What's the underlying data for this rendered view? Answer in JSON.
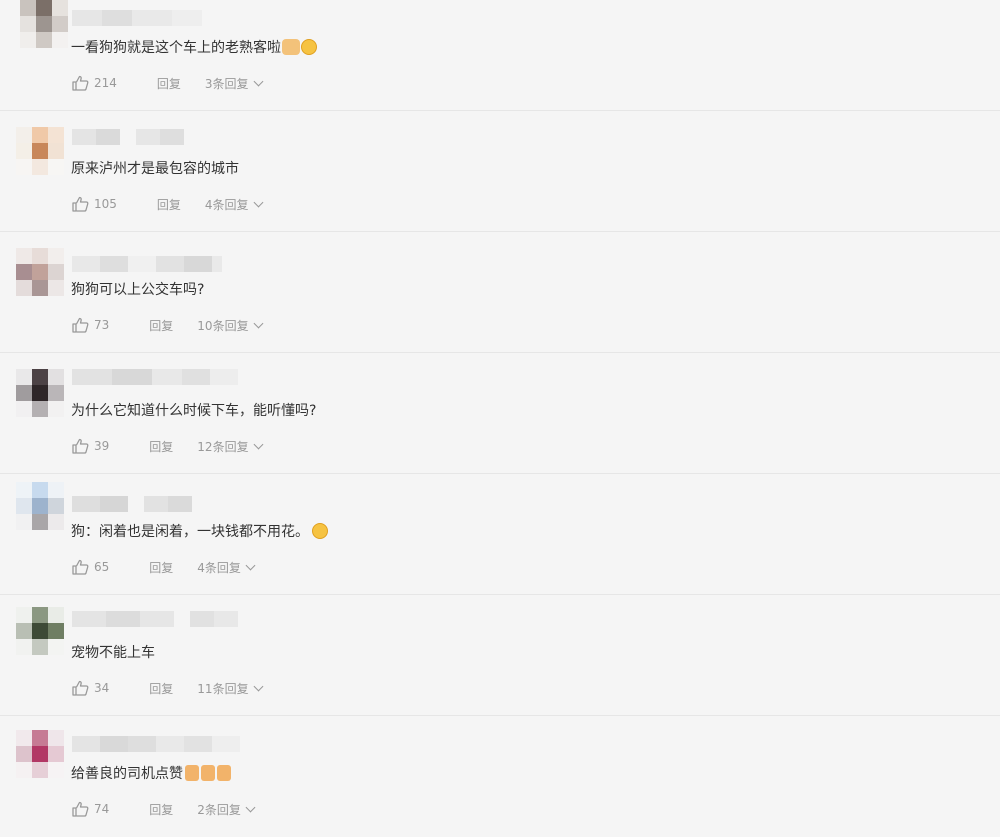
{
  "comments": [
    {
      "text": "一看狗狗就是这个车上的老熟客啦",
      "emoji": [
        "clap-emoji",
        "laugh-emoji"
      ],
      "likes": "214",
      "reply_label": "回复",
      "replies_label": "3条回复"
    },
    {
      "text": "原来泸州才是最包容的城市",
      "emoji": [],
      "likes": "105",
      "reply_label": "回复",
      "replies_label": "4条回复"
    },
    {
      "text": "狗狗可以上公交车吗?",
      "emoji": [],
      "likes": "73",
      "reply_label": "回复",
      "replies_label": "10条回复"
    },
    {
      "text": "为什么它知道什么时候下车，能听懂吗?",
      "emoji": [],
      "likes": "39",
      "reply_label": "回复",
      "replies_label": "12条回复"
    },
    {
      "text": "狗：闲着也是闲着，一块钱都不用花。",
      "emoji": [
        "smirk-emoji"
      ],
      "likes": "65",
      "reply_label": "回复",
      "replies_label": "4条回复"
    },
    {
      "text": "宠物不能上车",
      "emoji": [],
      "likes": "34",
      "reply_label": "回复",
      "replies_label": "11条回复"
    },
    {
      "text": "给善良的司机点赞",
      "emoji": [
        "thumbs-up-emoji",
        "thumbs-up-emoji",
        "thumbs-up-emoji"
      ],
      "likes": "74",
      "reply_label": "回复",
      "replies_label": "2条回复"
    }
  ],
  "colors": {
    "background": "#f5f5f5",
    "divider": "#e6e6e6",
    "text": "#333333",
    "meta": "#999999"
  }
}
